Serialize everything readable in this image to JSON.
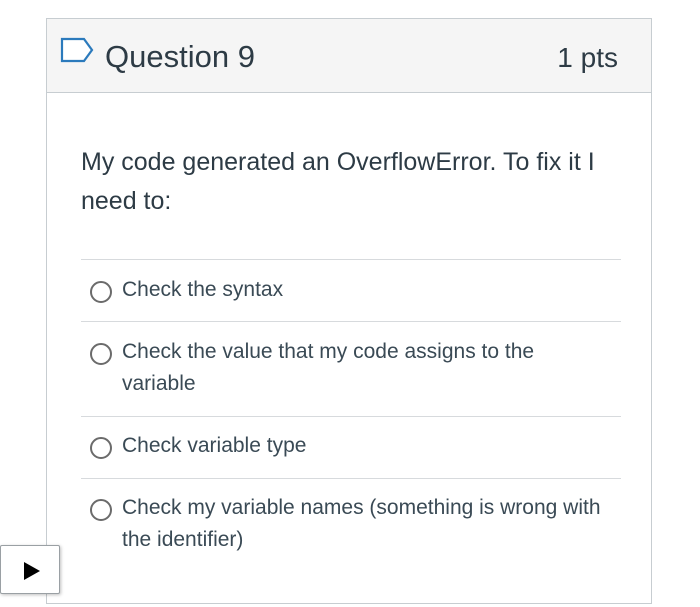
{
  "question": {
    "title": "Question 9",
    "points": "1 pts",
    "text": "My code generated an OverflowError. To fix it I need to:"
  },
  "answers": [
    {
      "label": "Check the syntax"
    },
    {
      "label": "Check the value that my code assigns to the variable"
    },
    {
      "label": "Check variable type"
    },
    {
      "label": "Check my variable names (something is wrong with the identifier)"
    }
  ],
  "icons": {
    "flag": "bookmark-flag-icon",
    "play": "play-icon"
  },
  "colors": {
    "header_bg": "#f5f5f5",
    "border": "#c7cdd1",
    "text": "#2d3b45",
    "flag": "#2b7abc"
  }
}
